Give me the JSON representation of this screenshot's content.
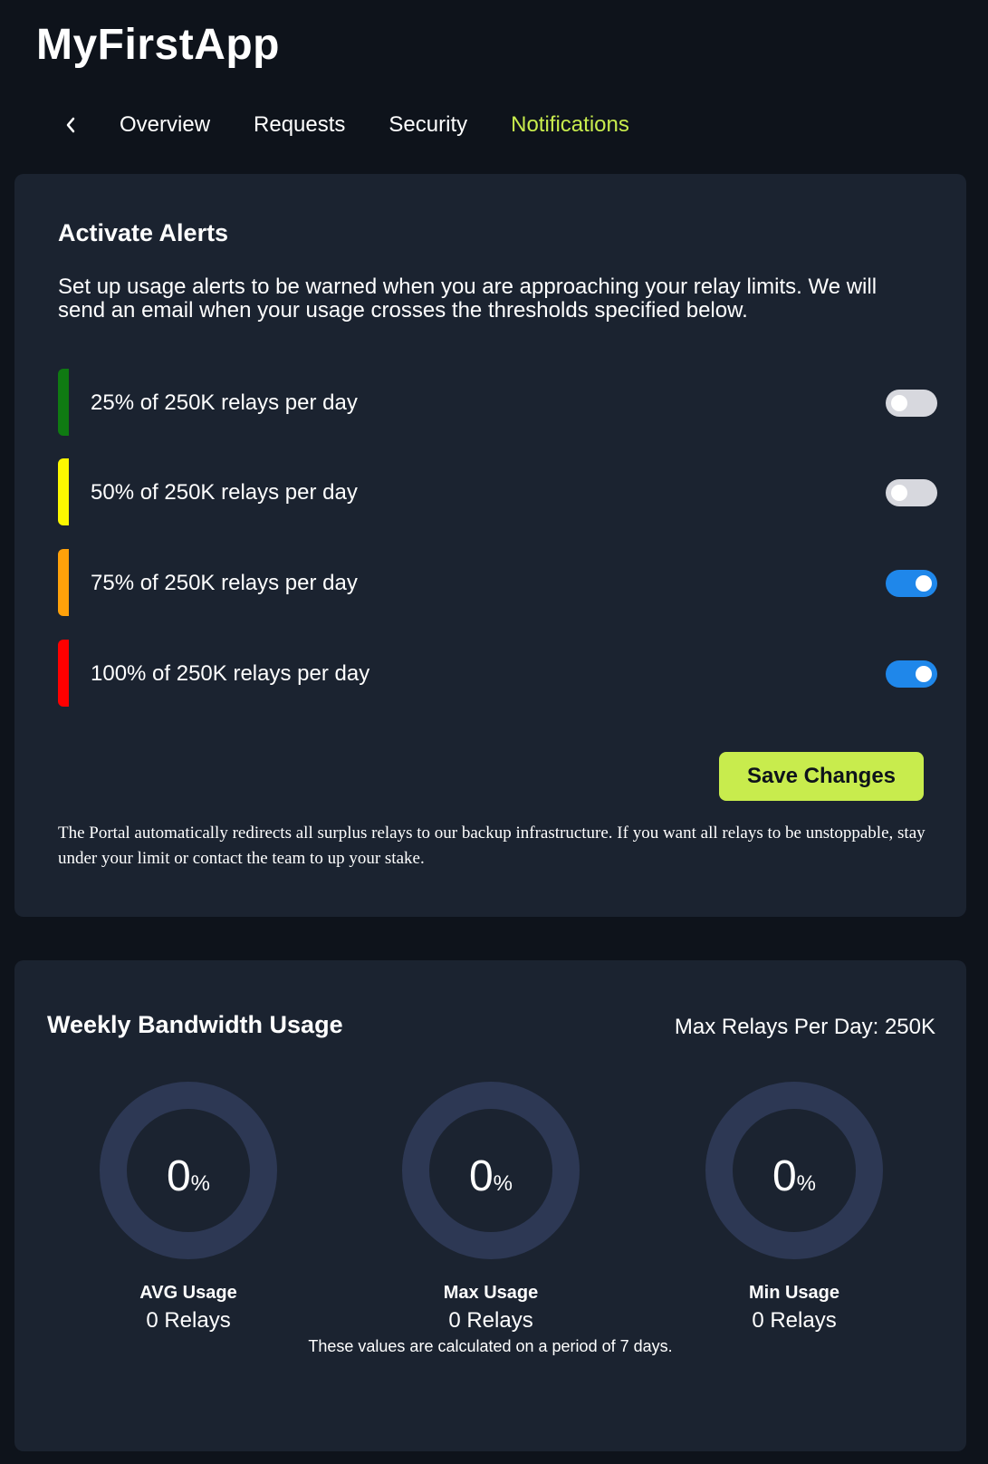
{
  "app": {
    "title": "MyFirstApp"
  },
  "nav": {
    "back_icon": "chevron-left-icon",
    "tabs": [
      {
        "label": "Overview",
        "active": false
      },
      {
        "label": "Requests",
        "active": false
      },
      {
        "label": "Security",
        "active": false
      },
      {
        "label": "Notifications",
        "active": true
      }
    ],
    "active_color": "#c8ec4d"
  },
  "alerts": {
    "title": "Activate Alerts",
    "description": "Set up usage alerts to be warned when you are approaching your relay limits. We will send an email when your usage crosses the thresholds specified below.",
    "items": [
      {
        "label": "25% of 250K relays per day",
        "color": "#0f7a12",
        "enabled": false
      },
      {
        "label": "50% of 250K relays per day",
        "color": "#fcf700",
        "enabled": false
      },
      {
        "label": "75% of 250K relays per day",
        "color": "#ffa10a",
        "enabled": true
      },
      {
        "label": "100% of 250K relays per day",
        "color": "#ff0000",
        "enabled": true
      }
    ],
    "save_label": "Save Changes",
    "footnote": "The Portal automatically redirects all surplus relays to our backup infrastructure. If you want all relays to be unstoppable, stay under your limit or contact the team to up your stake."
  },
  "usage": {
    "title": "Weekly Bandwidth Usage",
    "max_relays": "Max Relays Per Day: 250K",
    "gauges": [
      {
        "value": "0",
        "unit": "%",
        "label": "AVG Usage",
        "relays": "0 Relays"
      },
      {
        "value": "0",
        "unit": "%",
        "label": "Max Usage",
        "relays": "0 Relays"
      },
      {
        "value": "0",
        "unit": "%",
        "label": "Min Usage",
        "relays": "0 Relays"
      }
    ],
    "note": "These values are calculated on a period of 7 days."
  }
}
